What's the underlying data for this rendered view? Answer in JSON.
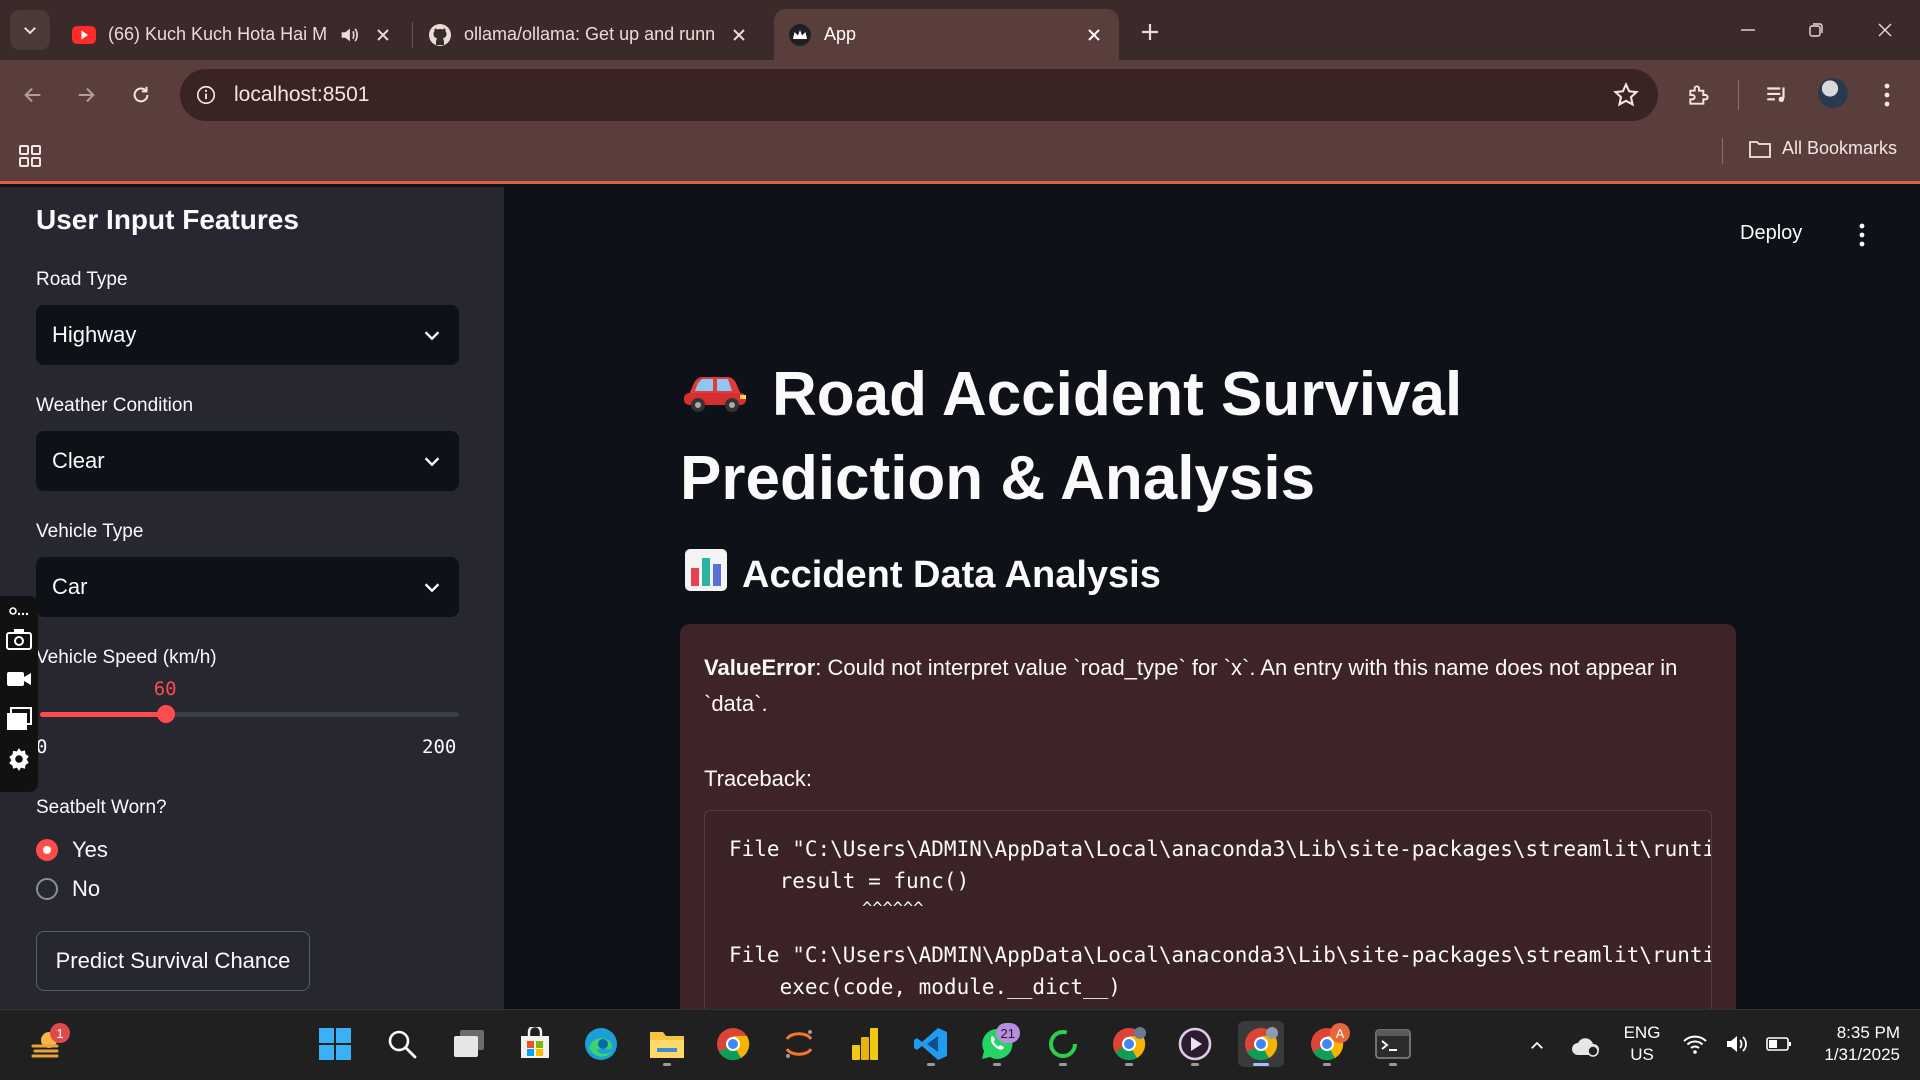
{
  "browser": {
    "tabs": [
      {
        "title": "(66) Kuch Kuch Hota Hai M",
        "active": false
      },
      {
        "title": "ollama/ollama: Get up and runn",
        "active": false
      },
      {
        "title": "App",
        "active": true
      }
    ],
    "url": "localhost:8501",
    "bookmarks_label": "All Bookmarks"
  },
  "sidebar": {
    "title": "User Input Features",
    "road_type": {
      "label": "Road Type",
      "value": "Highway"
    },
    "weather": {
      "label": "Weather Condition",
      "value": "Clear"
    },
    "vehicle_type": {
      "label": "Vehicle Type",
      "value": "Car"
    },
    "speed": {
      "label": "Vehicle Speed (km/h)",
      "value": 60,
      "min": 0,
      "max": 200,
      "value_text": "60",
      "min_text": "0",
      "max_text": "200"
    },
    "seatbelt": {
      "label": "Seatbelt Worn?",
      "options": [
        "Yes",
        "No"
      ],
      "selected": "Yes"
    },
    "predict_button": "Predict Survival Chance"
  },
  "header": {
    "deploy_label": "Deploy"
  },
  "main": {
    "title": "Road Accident Survival Prediction & Analysis",
    "section_title": "Accident Data Analysis",
    "error": {
      "type": "ValueError",
      "message": ": Could not interpret value `road_type` for `x`. An entry with this name does not appear in `data`.",
      "traceback_label": "Traceback:",
      "lines": [
        "File \"C:\\Users\\ADMIN\\AppData\\Local\\anaconda3\\Lib\\site-packages\\streamlit\\runti",
        "    result = func()",
        "             ^^^^^^",
        "File \"C:\\Users\\ADMIN\\AppData\\Local\\anaconda3\\Lib\\site-packages\\streamlit\\runti",
        "    exec(code, module.__dict__)"
      ]
    }
  },
  "taskbar": {
    "weather_badge": "1",
    "whatsapp_badge": "21",
    "chrome2_badge": "A",
    "lang_line1": "ENG",
    "lang_line2": "US",
    "time": "8:35 PM",
    "date": "1/31/2025"
  },
  "colors": {
    "accent": "#ff4b4b",
    "sidebar_bg": "#262730",
    "main_bg": "#0e1117",
    "error_bg": "#3e2428",
    "chrome_bg": "#5a3e3b"
  }
}
